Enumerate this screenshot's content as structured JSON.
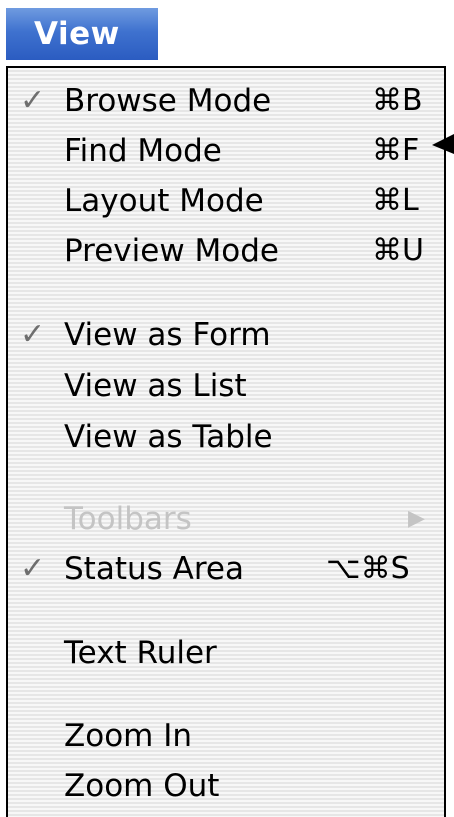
{
  "menubar": {
    "title": "View"
  },
  "menu": {
    "mode_items": [
      {
        "label": "Browse Mode",
        "shortcut": "⌘B",
        "checked": true,
        "check_mark": "✓"
      },
      {
        "label": "Find Mode",
        "shortcut": "⌘F",
        "checked": false,
        "check_mark": ""
      },
      {
        "label": "Layout Mode",
        "shortcut": "⌘L",
        "checked": false,
        "check_mark": ""
      },
      {
        "label": "Preview Mode",
        "shortcut": "⌘U",
        "checked": false,
        "check_mark": ""
      }
    ],
    "view_items": [
      {
        "label": "View as Form",
        "checked": true,
        "check_mark": "✓"
      },
      {
        "label": "View as List",
        "checked": false,
        "check_mark": ""
      },
      {
        "label": "View as Table",
        "checked": false,
        "check_mark": ""
      }
    ],
    "toolbars": {
      "label": "Toolbars",
      "enabled": false,
      "has_submenu": true,
      "submenu_glyph": "▶"
    },
    "status_area": {
      "label": "Status Area",
      "shortcut": "⌥⌘S",
      "checked": true,
      "check_mark": "✓"
    },
    "text_ruler": {
      "label": "Text Ruler"
    },
    "zoom_items": [
      {
        "label": "Zoom In"
      },
      {
        "label": "Zoom Out"
      }
    ]
  },
  "colors": {
    "menubar_highlight": "#3f72cf",
    "disabled_text": "#c4c4c4",
    "checkmark": "#6e6e6e"
  }
}
